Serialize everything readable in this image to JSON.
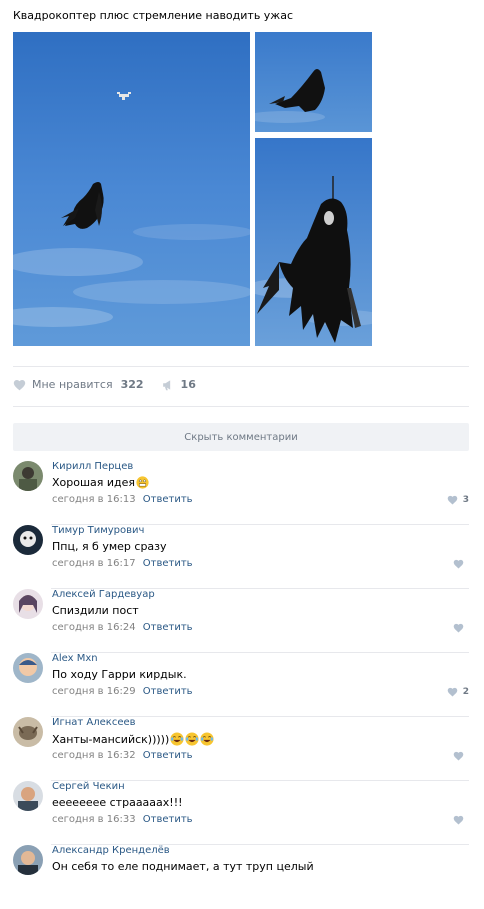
{
  "post": {
    "text": "Квадрокоптер плюс стремление наводить ужас"
  },
  "actions": {
    "like_label": "Мне нравится",
    "like_count": "322",
    "share_count": "16"
  },
  "comments_toggle": "Скрыть комментарии",
  "comments": [
    {
      "author": "Кирилл Перцев",
      "text": "Хорошая идея",
      "time": "сегодня в 16:13",
      "reply": "Ответить",
      "likes": "3"
    },
    {
      "author": "Тимур Тимурович",
      "text": "Ппц, я б умер сразу",
      "time": "сегодня в 16:17",
      "reply": "Ответить",
      "likes": ""
    },
    {
      "author": "Алексей Гардевуар",
      "text": "Спиздили пост",
      "time": "сегодня в 16:24",
      "reply": "Ответить",
      "likes": ""
    },
    {
      "author": "Alex Mxn",
      "text": "По ходу Гарри кирдык.",
      "time": "сегодня в 16:29",
      "reply": "Ответить",
      "likes": "2"
    },
    {
      "author": "Игнат Алексеев",
      "text": "Ханты-мансийск)))))",
      "time": "сегодня в 16:32",
      "reply": "Ответить",
      "likes": ""
    },
    {
      "author": "Сергей Чекин",
      "text": "ееееееее страааааx!!!",
      "time": "сегодня в 16:33",
      "reply": "Ответить",
      "likes": ""
    },
    {
      "author": "Александр Кренделёв",
      "text": "Он себя то еле поднимает, а тут труп целый",
      "time": "",
      "reply": "",
      "likes": ""
    }
  ],
  "icons": {
    "heart": "heart-icon",
    "share": "megaphone-icon",
    "emoji_grimace": "grimace-emoji",
    "emoji_laugh": "tears-of-joy-emoji"
  },
  "colors": {
    "link": "#2a5885",
    "muted": "#6f7985",
    "sky": "#3b78c8",
    "divider": "#e7e8ec"
  }
}
